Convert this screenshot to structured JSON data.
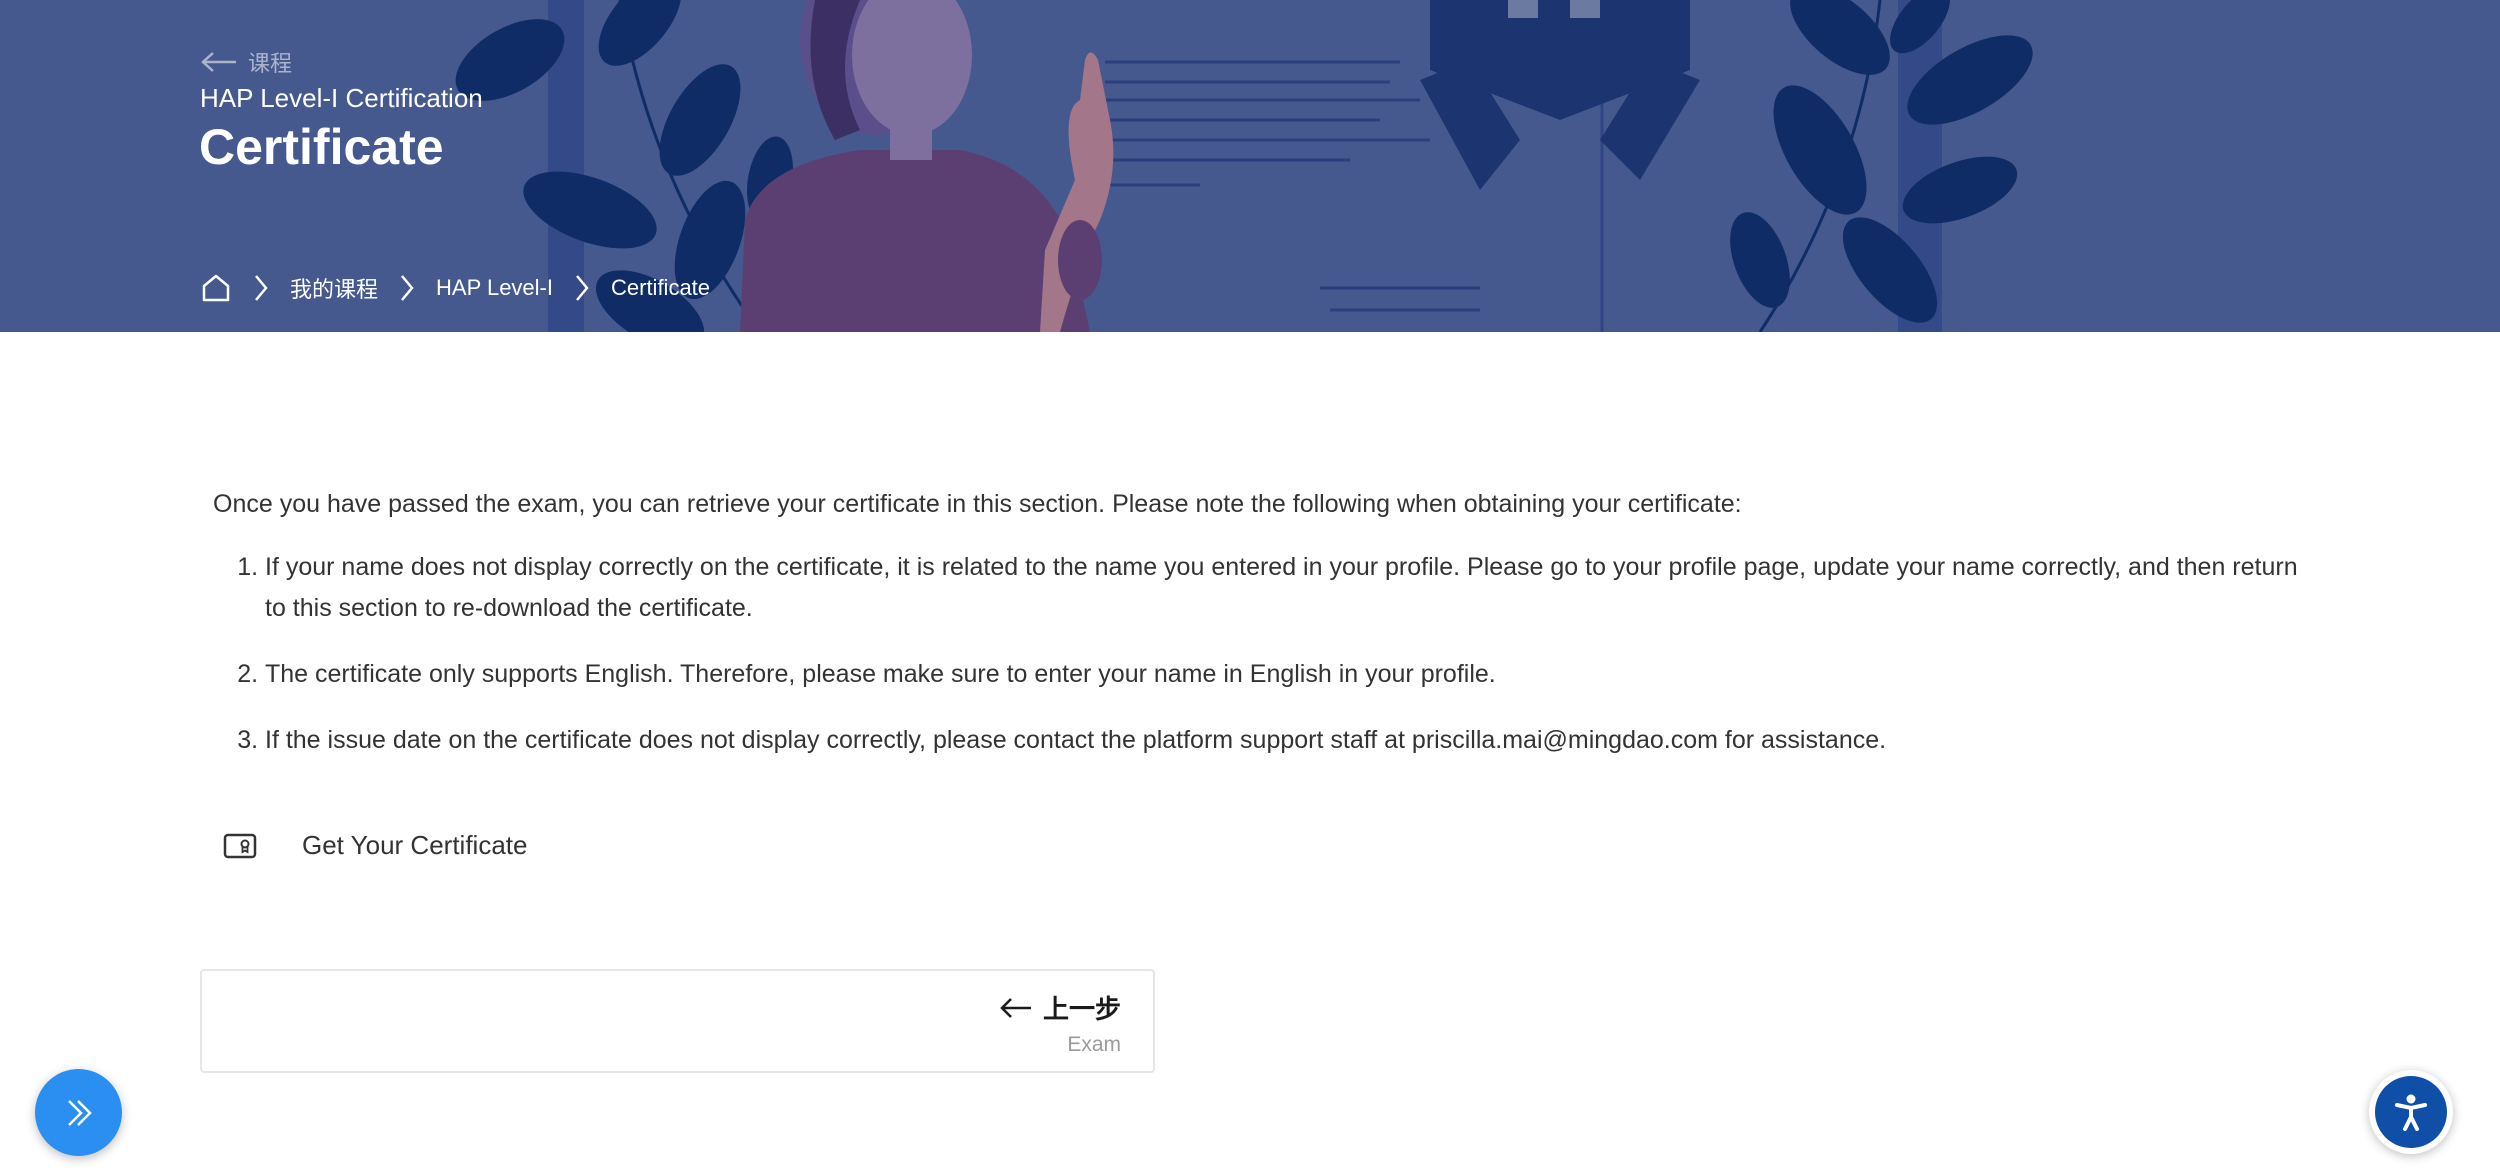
{
  "header": {
    "back_label": "课程",
    "course_subtitle": "HAP Level-I Certification",
    "title": "Certificate",
    "breadcrumb": [
      "我的课程",
      "HAP Level-I",
      "Certificate"
    ],
    "background_color": "#45598f"
  },
  "content": {
    "intro": "Once you have passed the exam, you can retrieve your certificate in this section. Please note the following when obtaining your certificate:",
    "notes": [
      "If your name does not display correctly on the certificate, it is related to the name you entered in your profile. Please go to your profile page, update your name correctly, and then return to this section to re-download the certificate.",
      "The certificate only supports English. Therefore, please make sure to enter your name in English in your profile.",
      "If the issue date on the certificate does not display correctly, please contact the platform support staff at priscilla.mai@mingdao.com for assistance."
    ]
  },
  "certificate_item": {
    "label": "Get Your Certificate",
    "icon": "certificate-icon"
  },
  "prev_card": {
    "title": "上一步",
    "subtitle": "Exam"
  },
  "floating": {
    "left_icon": "double-chevron-right-icon",
    "left_color": "#2a8ff0",
    "right_icon": "accessibility-icon",
    "right_color": "#0f4fa8"
  }
}
